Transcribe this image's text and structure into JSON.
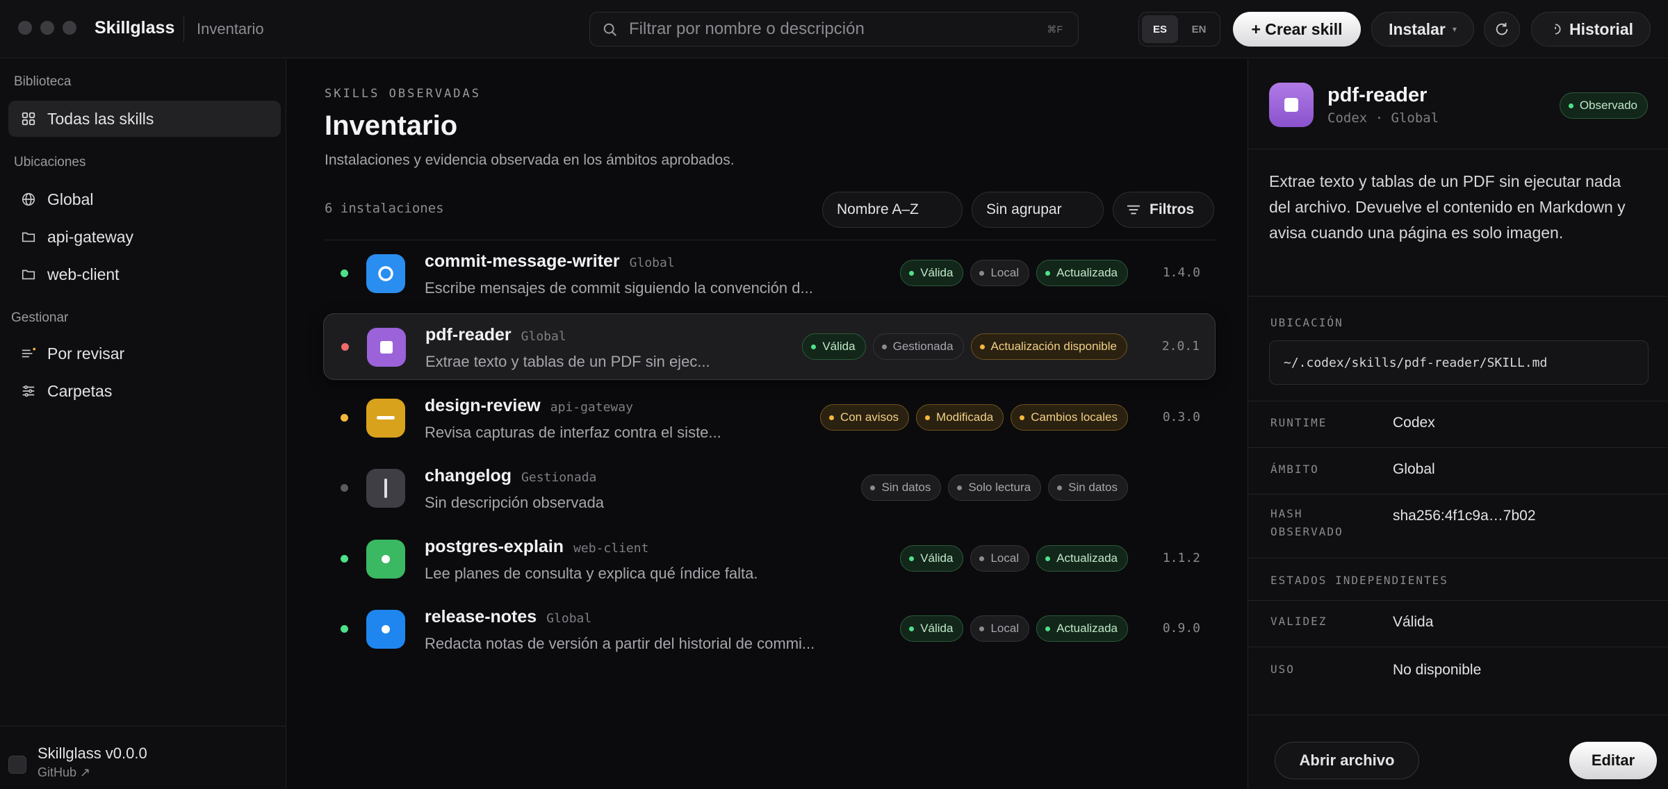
{
  "titlebar": {
    "app_name": "Skillglass",
    "section": "Inventario",
    "search_placeholder": "Filtrar por nombre o descripción",
    "search_shortcut": "⌘F",
    "languages": [
      {
        "label": "ES",
        "active": true
      },
      {
        "label": "EN",
        "active": false
      }
    ],
    "create_label": "+ Crear skill",
    "install_label": "Instalar",
    "history_label": "Historial"
  },
  "sidebar": {
    "library_heading": "Biblioteca",
    "all_skills_label": "Todas las skills",
    "locations_heading": "Ubicaciones",
    "locations": [
      "Global",
      "api-gateway",
      "web-client"
    ],
    "manage_heading": "Gestionar",
    "manage_items": [
      "Por revisar",
      "Carpetas"
    ],
    "footer_version": "Skillglass v0.0.0",
    "footer_link": "GitHub ↗"
  },
  "main": {
    "eyebrow": "SKILLS OBSERVADAS",
    "title": "Inventario",
    "subtitle": "Instalaciones y evidencia observada en los ámbitos aprobados.",
    "count": "6 instalaciones",
    "sort_label": "Nombre A–Z",
    "group_label": "Sin agrupar",
    "filters_label": "Filtros"
  },
  "skills": [
    {
      "name": "commit-message-writer",
      "scope": "Global",
      "desc": "Escribe mensajes de commit siguiendo la convención d...",
      "version": "1.4.0",
      "dot": "#4ee08a",
      "icon_color": "#2a8ef0",
      "icon": "ring",
      "badges": [
        {
          "label": "Válida",
          "tone": "green"
        },
        {
          "label": "Local",
          "tone": "gray"
        },
        {
          "label": "Actualizada",
          "tone": "green"
        }
      ]
    },
    {
      "name": "pdf-reader",
      "scope": "Global",
      "desc": "Extrae texto y tablas de un PDF sin ejec...",
      "version": "2.0.1",
      "dot": "#f06a6a",
      "icon_color": "#9b62d9",
      "icon": "square",
      "selected": true,
      "badges": [
        {
          "label": "Válida",
          "tone": "green"
        },
        {
          "label": "Gestionada",
          "tone": "gray"
        },
        {
          "label": "Actualización disponible",
          "tone": "amber"
        }
      ]
    },
    {
      "name": "design-review",
      "scope": "api-gateway",
      "desc": "Revisa capturas de interfaz contra el siste...",
      "version": "0.3.0",
      "dot": "#f5b83d",
      "icon_color": "#d8a21c",
      "icon": "dash",
      "badges": [
        {
          "label": "Con avisos",
          "tone": "amber"
        },
        {
          "label": "Modificada",
          "tone": "amber"
        },
        {
          "label": "Cambios locales",
          "tone": "amber"
        }
      ]
    },
    {
      "name": "changelog",
      "scope": "Gestionada",
      "desc": "Sin descripción observada",
      "version": "",
      "dot": "#5a5a60",
      "icon_color": "#3e3e44",
      "icon": "bar",
      "badges": [
        {
          "label": "Sin datos",
          "tone": "gray"
        },
        {
          "label": "Solo lectura",
          "tone": "gray"
        },
        {
          "label": "Sin datos",
          "tone": "gray"
        }
      ]
    },
    {
      "name": "postgres-explain",
      "scope": "web-client",
      "desc": "Lee planes de consulta y explica qué índice falta.",
      "version": "1.1.2",
      "dot": "#4ee08a",
      "icon_color": "#3bb862",
      "icon": "dot",
      "badges": [
        {
          "label": "Válida",
          "tone": "green"
        },
        {
          "label": "Local",
          "tone": "gray"
        },
        {
          "label": "Actualizada",
          "tone": "green"
        }
      ]
    },
    {
      "name": "release-notes",
      "scope": "Global",
      "desc": "Redacta notas de versión a partir del historial de commi...",
      "version": "0.9.0",
      "dot": "#4ee08a",
      "icon_color": "#1f86f0",
      "icon": "dot",
      "badges": [
        {
          "label": "Válida",
          "tone": "green"
        },
        {
          "label": "Local",
          "tone": "gray"
        },
        {
          "label": "Actualizada",
          "tone": "green"
        }
      ]
    }
  ],
  "detail": {
    "name": "pdf-reader",
    "meta": "Codex · Global",
    "status": "Observado",
    "description": "Extrae texto y tablas de un PDF sin ejecutar nada del archivo. Devuelve el contenido en Markdown y avisa cuando una página es solo imagen.",
    "location_label": "UBICACIÓN",
    "location_path": "~/.codex/skills/pdf-reader/SKILL.md",
    "runtime_label": "RUNTIME",
    "runtime_value": "Codex",
    "scope_label": "ÁMBITO",
    "scope_value": "Global",
    "hash_label": "HASH OBSERVADO",
    "hash_value": "sha256:4f1c9a…7b02",
    "states_heading": "ESTADOS INDEPENDIENTES",
    "validity_label": "VALIDEZ",
    "validity_value": "Válida",
    "usage_label": "USO",
    "usage_value": "No disponible",
    "open_label": "Abrir archivo",
    "edit_label": "Editar"
  }
}
